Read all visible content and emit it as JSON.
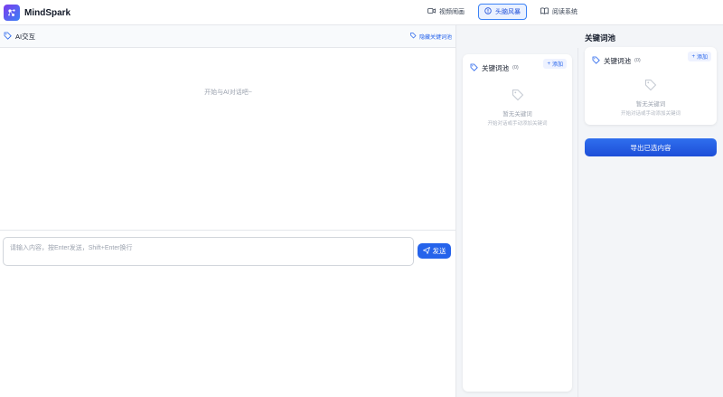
{
  "app": {
    "name": "MindSpark"
  },
  "nav": [
    {
      "label": "视频闹画",
      "icon": "video-icon",
      "active": false
    },
    {
      "label": "头脑风暴",
      "icon": "bulb-icon",
      "active": true
    },
    {
      "label": "阅读系统",
      "icon": "book-icon",
      "active": false
    }
  ],
  "chat": {
    "title": "AI交互",
    "hide_pool_label": "隐藏关键词池",
    "empty_text": "开始与AI对话吧~",
    "input_placeholder": "请输入内容，按Enter发送，Shift+Enter换行",
    "send_label": "发送"
  },
  "keyword_pool_mid": {
    "title": "关键词池",
    "count": "(0)",
    "add_label": "添加",
    "empty_title": "暂无关键词",
    "empty_sub": "开始对话或手动添加关键词"
  },
  "keyword_pool_right": {
    "header": "关键词池",
    "title": "关键词池",
    "count": "(0)",
    "add_label": "添加",
    "empty_title": "暂无关键词",
    "empty_sub": "开始对话或手动添加关键词",
    "export_label": "导出已选内容"
  },
  "colors": {
    "accent": "#2563eb",
    "brand_gradient_start": "#7c3aed",
    "brand_gradient_end": "#3b82f6"
  }
}
